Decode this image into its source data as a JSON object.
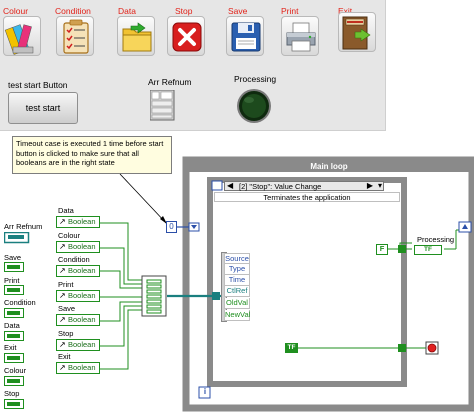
{
  "toolbar": [
    {
      "label": "Colour",
      "icon": "color-swatch-icon"
    },
    {
      "label": "Condition",
      "icon": "checklist-icon"
    },
    {
      "label": "Data",
      "icon": "folder-icon"
    },
    {
      "label": "Stop",
      "icon": "stop-x-icon"
    },
    {
      "label": "Save",
      "icon": "floppy-disk-icon"
    },
    {
      "label": "Print",
      "icon": "printer-icon"
    },
    {
      "label": "Exit",
      "icon": "exit-door-icon"
    }
  ],
  "front_panel": {
    "test_start_label": "test start Button",
    "test_start_button": "test start",
    "arr_refnum_label": "Arr Refnum",
    "processing_label": "Processing"
  },
  "comment": "Timeout case is executed 1 time before start button is clicked to make sure that all booleans are in the right state",
  "left_terminals": [
    "Arr Refnum",
    "Save",
    "Print",
    "Condition",
    "Data",
    "Exit",
    "Colour",
    "Stop"
  ],
  "boolean_refs": [
    {
      "label": "Data",
      "value": "Boolean"
    },
    {
      "label": "Colour",
      "value": "Boolean"
    },
    {
      "label": "Condition",
      "value": "Boolean"
    },
    {
      "label": "Print",
      "value": "Boolean"
    },
    {
      "label": "Save",
      "value": "Boolean"
    },
    {
      "label": "Stop",
      "value": "Boolean"
    },
    {
      "label": "Exit",
      "value": "Boolean"
    }
  ],
  "timeout_constant": "0",
  "loop": {
    "title": "Main loop",
    "event_case": "[2] \"Stop\": Value Change",
    "description": "Terminates the application",
    "event_data": [
      "Source",
      "Type",
      "Time",
      "CtlRef",
      "OldVal",
      "NewVal"
    ],
    "processing_label": "Processing",
    "processing_terminal": "TF",
    "iteration": "i",
    "bool_const_inner": "F",
    "bool_const_outer": "TF"
  },
  "colors": {
    "toolbar_label": "#e2231a",
    "boolean_wire": "#1f8f1f",
    "refnum_wire": "#1a7f7f",
    "loop_frame": "#8a8a8a",
    "comment_bg": "#fffde0"
  }
}
